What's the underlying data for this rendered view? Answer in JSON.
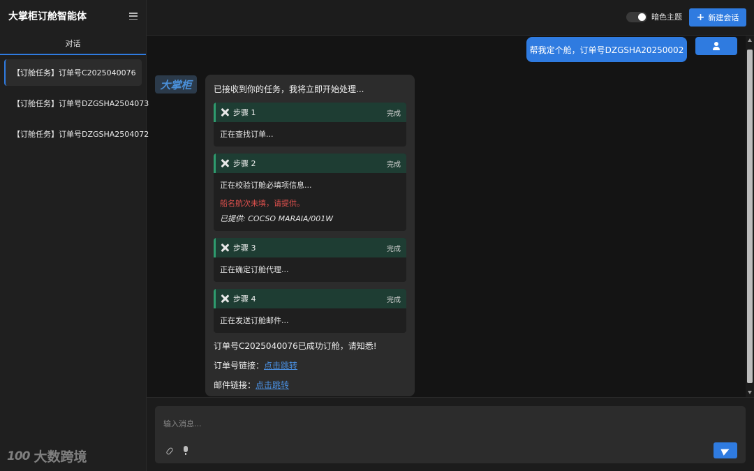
{
  "sidebar": {
    "title": "大掌柜订舱智能体",
    "tab": "对话",
    "conversations": [
      {
        "label": "【订舱任务】订单号C2025040076"
      },
      {
        "label": "【订舱任务】订单号DZGSHA2504073"
      },
      {
        "label": "【订舱任务】订单号DZGSHA2504072"
      }
    ],
    "watermark_mark": "100",
    "watermark_text": "大数跨境"
  },
  "topbar": {
    "theme_label": "暗色主题",
    "dark_theme_on": true,
    "new_chat_label": "新建会话"
  },
  "chat": {
    "user_message": "帮我定个舱，订单号DZGSHA20250002",
    "bot_avatar_text": "大掌柜",
    "bot_intro": "已接收到你的任务，我将立即开始处理...",
    "steps": [
      {
        "title": "步骤 1",
        "status": "完成",
        "text": "正在查找订单..."
      },
      {
        "title": "步骤 2",
        "status": "完成",
        "text": "正在校验订舱必填项信息...",
        "warning": "船名航次未填，请提供。",
        "provided": "已提供: COCSO MARAIA/001W"
      },
      {
        "title": "步骤 3",
        "status": "完成",
        "text": "正在确定订舱代理..."
      },
      {
        "title": "步骤 4",
        "status": "完成",
        "text": "正在发送订舱邮件..."
      }
    ],
    "result": "订单号C2025040076已成功订舱，请知悉!",
    "order_link_label": "订单号链接：",
    "order_link_text": "点击跳转",
    "mail_link_label": "邮件链接：",
    "mail_link_text": "点击跳转"
  },
  "composer": {
    "placeholder": "输入消息..."
  },
  "colors": {
    "accent": "#2f7be0",
    "step_header": "#1e3d33",
    "warning": "#e0514e",
    "link": "#4a8fe0"
  },
  "icons": [
    "menu-icon",
    "plus-icon",
    "user-icon",
    "tool-icon",
    "paperclip-icon",
    "mic-icon",
    "send-icon"
  ]
}
